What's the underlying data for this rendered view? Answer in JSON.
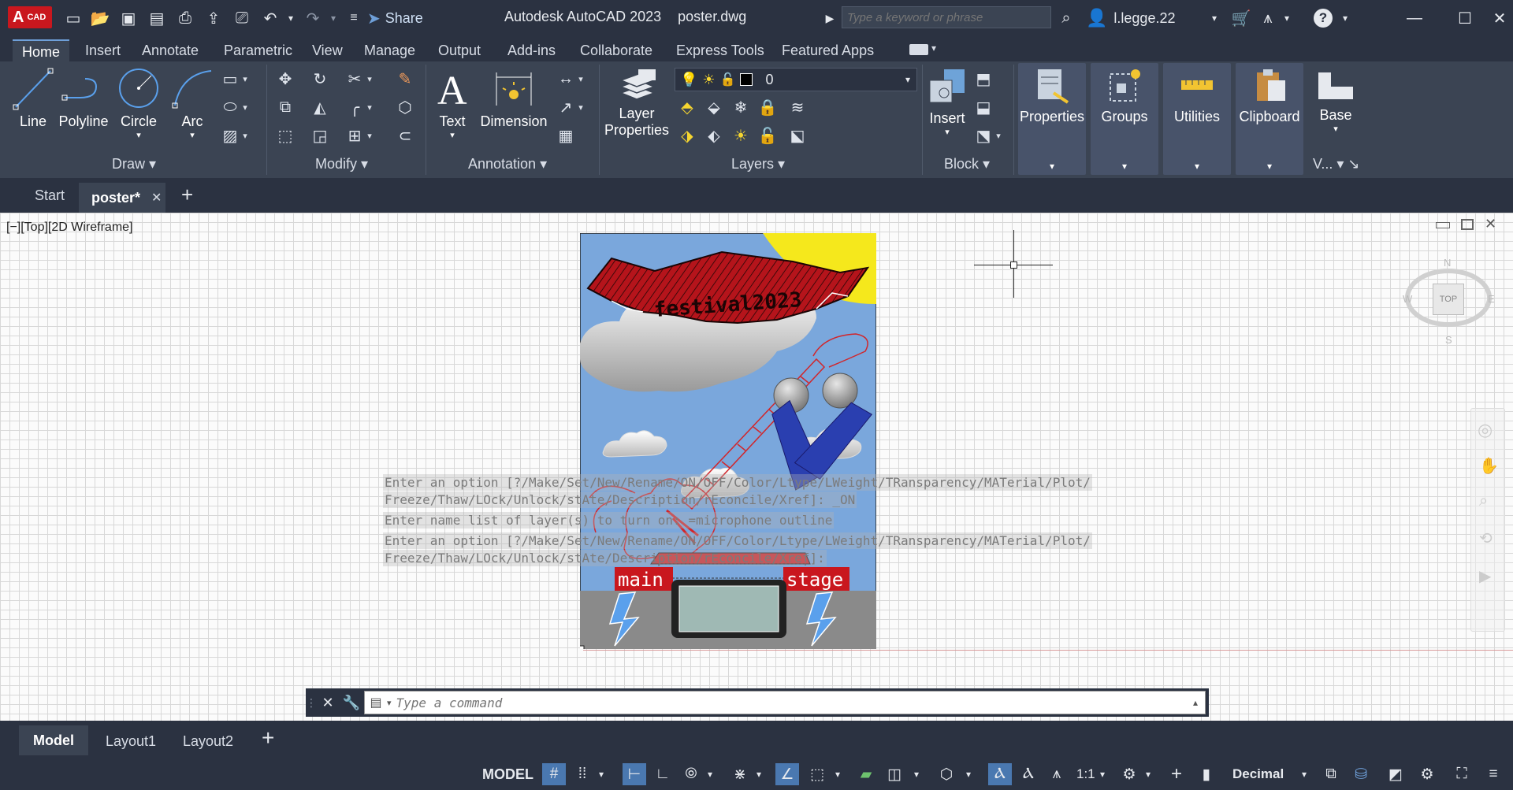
{
  "app": {
    "logo_main": "A",
    "logo_sub": "CAD",
    "share_label": "Share",
    "title": "Autodesk AutoCAD 2023",
    "filename": "poster.dwg",
    "search_placeholder": "Type a keyword or phrase",
    "username": "l.legge.22"
  },
  "ribbon_tabs": [
    "Home",
    "Insert",
    "Annotate",
    "Parametric",
    "View",
    "Manage",
    "Output",
    "Add-ins",
    "Collaborate",
    "Express Tools",
    "Featured Apps"
  ],
  "ribbon": {
    "draw": {
      "line": "Line",
      "polyline": "Polyline",
      "circle": "Circle",
      "arc": "Arc",
      "title": "Draw"
    },
    "modify": {
      "title": "Modify"
    },
    "annotation": {
      "text": "Text",
      "dimension": "Dimension",
      "title": "Annotation"
    },
    "layers": {
      "layer_properties_1": "Layer",
      "layer_properties_2": "Properties",
      "current_layer": "0",
      "title": "Layers"
    },
    "block": {
      "insert": "Insert",
      "title": "Block"
    },
    "properties": "Properties",
    "groups": "Groups",
    "utilities": "Utilities",
    "clipboard": "Clipboard",
    "base": "Base",
    "view_short": "V..."
  },
  "doc_tabs": {
    "start": "Start",
    "poster": "poster*"
  },
  "viewport": {
    "label": "[−][Top][2D Wireframe]",
    "viewcube": {
      "top": "TOP",
      "n": "N",
      "s": "S",
      "e": "E",
      "w": "W"
    }
  },
  "poster": {
    "banner_text": "festival2023",
    "stage_left": "main",
    "stage_right": "stage"
  },
  "command_history": [
    "Enter an option [?/Make/Set/New/Rename/ON/OFF/Color/Ltype/LWeight/TRansparency/MATerial/Plot/",
    "Freeze/Thaw/LOck/Unlock/stAte/Description/rEconcile/Xref]: _ON",
    "Enter name list of layer(s) to turn on: =microphone outline",
    "Enter an option [?/Make/Set/New/Rename/ON/OFF/Color/Ltype/LWeight/TRansparency/MATerial/Plot/",
    "Freeze/Thaw/LOck/Unlock/stAte/Description/rEconcile/Xref]:"
  ],
  "command_placeholder": "Type a command",
  "layout_tabs": [
    "Model",
    "Layout1",
    "Layout2"
  ],
  "status": {
    "model": "MODEL",
    "scale": "1:1",
    "units": "Decimal"
  },
  "colors": {
    "accent": "#6e9fd8",
    "banner_red": "#c9171e",
    "sky": "#7aa7dc",
    "sun": "#f5e81c",
    "guitar": "#d1262b",
    "mic_blue": "#2a3fb0"
  }
}
